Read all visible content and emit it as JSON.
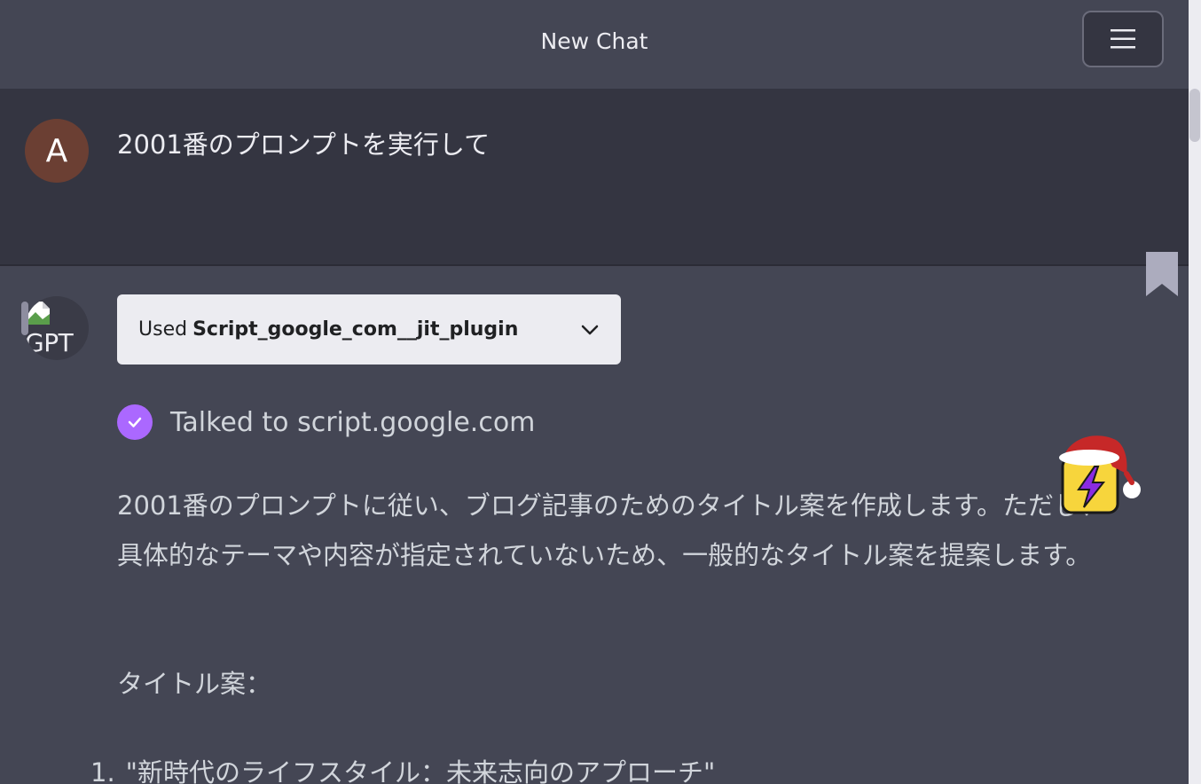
{
  "header": {
    "title": "New Chat"
  },
  "user_message": {
    "avatar_letter": "A",
    "text": "2001番のプロンプトを実行して"
  },
  "assistant_message": {
    "avatar_alt": "GPT",
    "plugin": {
      "used_label": "Used",
      "plugin_name": "Script_google_com__jit_plugin"
    },
    "talked_to": "Talked to script.google.com",
    "paragraph": "2001番のプロンプトに従い、ブログ記事のためのタイトル案を作成します。ただし、具体的なテーマや内容が指定されていないため、一般的なタイトル案を提案します。",
    "title_label": "タイトル案：",
    "list": [
      {
        "number": "1.",
        "text": "\"新時代のライフスタイル：未来志向のアプローチ\""
      }
    ]
  },
  "colors": {
    "background": "#444654",
    "user_background": "#343541",
    "avatar_user": "#6b3f33",
    "check_accent": "#ab68ff",
    "plugin_box": "#ececf1"
  },
  "icons": [
    "menu-icon",
    "bookmark-icon",
    "broken-image-icon",
    "chevron-down-icon",
    "check-icon",
    "lightning-extension-icon"
  ]
}
